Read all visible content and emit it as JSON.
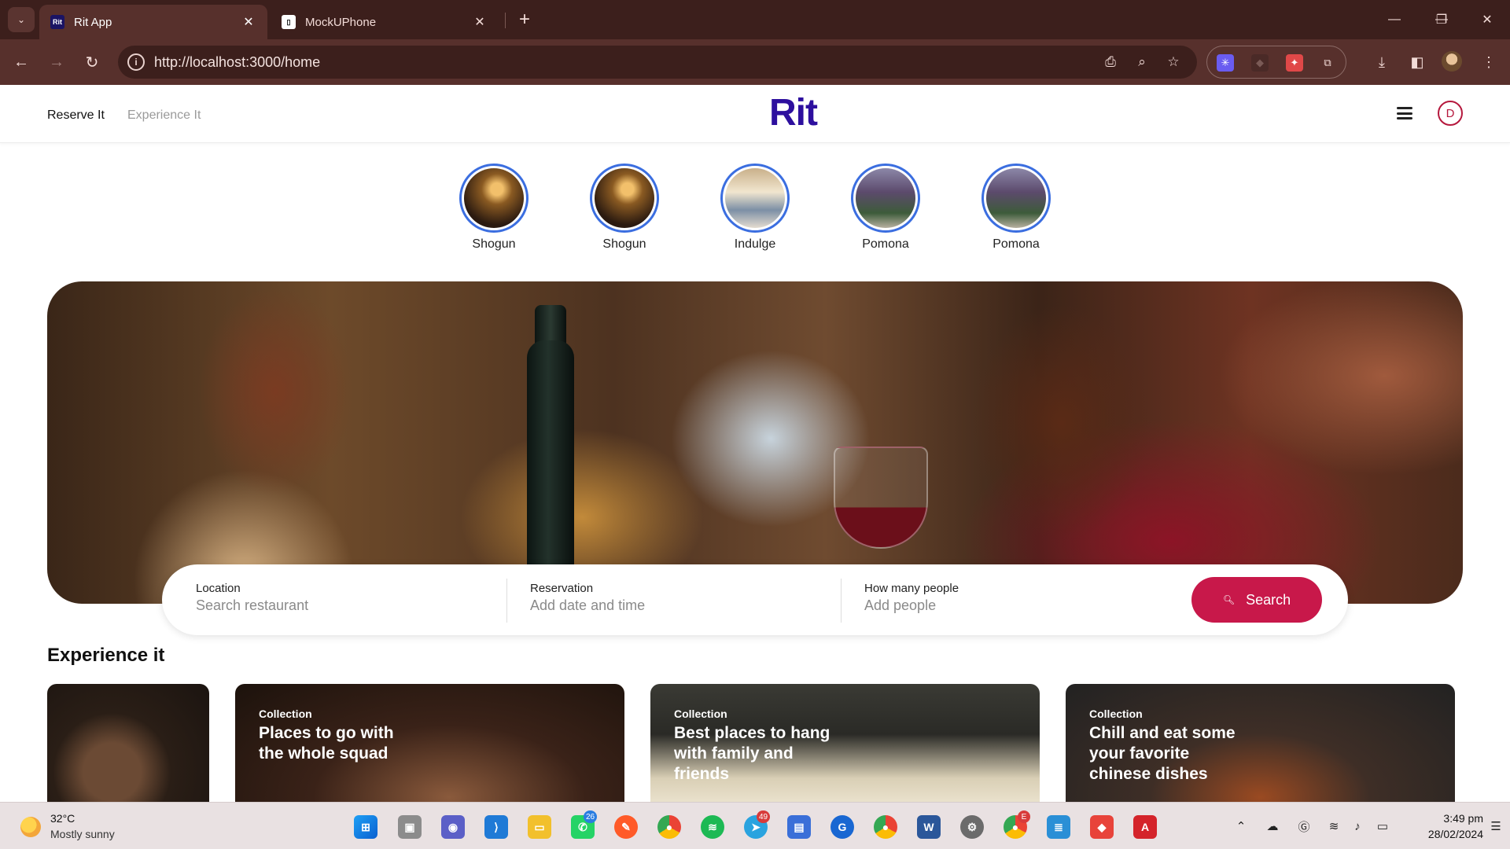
{
  "browser": {
    "tabs": [
      {
        "title": "Rit App",
        "favicon": "Rit",
        "active": true
      },
      {
        "title": "MockUPhone",
        "favicon": "▯",
        "active": false
      }
    ],
    "url": "http://localhost:3000/home",
    "tab_close_glyph": "✕",
    "new_tab_glyph": "+",
    "window_controls": {
      "minimize": "—",
      "maximize": "❐",
      "close": "✕"
    }
  },
  "site": {
    "nav": {
      "reserve": "Reserve It",
      "experience": "Experience It"
    },
    "logo": "Rit",
    "avatar_initial": "D",
    "accent_color": "#c8184a",
    "logo_color": "#2d0f9e"
  },
  "stories": [
    {
      "label": "Shogun"
    },
    {
      "label": "Shogun"
    },
    {
      "label": "Indulge"
    },
    {
      "label": "Pomona"
    },
    {
      "label": "Pomona"
    }
  ],
  "search": {
    "location": {
      "label": "Location",
      "placeholder": "Search restaurant"
    },
    "reservation": {
      "label": "Reservation",
      "placeholder": "Add date and time"
    },
    "people": {
      "label": "How many people",
      "placeholder": "Add people"
    },
    "button": "Search"
  },
  "experience": {
    "title": "Experience it",
    "cards": [
      {
        "kicker": "",
        "title": ""
      },
      {
        "kicker": "Collection",
        "title": "Places to go with the whole squad"
      },
      {
        "kicker": "Collection",
        "title": "Best places to hang with family and friends"
      },
      {
        "kicker": "Collection",
        "title": "Chill and eat some your favorite chinese dishes"
      }
    ]
  },
  "taskbar": {
    "weather": {
      "temp": "32°C",
      "desc": "Mostly sunny"
    },
    "badges": {
      "whatsapp": "26",
      "telegram": "49",
      "chrome_profile": "E"
    },
    "clock": {
      "time": "3:49 pm",
      "date": "28/02/2024"
    }
  }
}
